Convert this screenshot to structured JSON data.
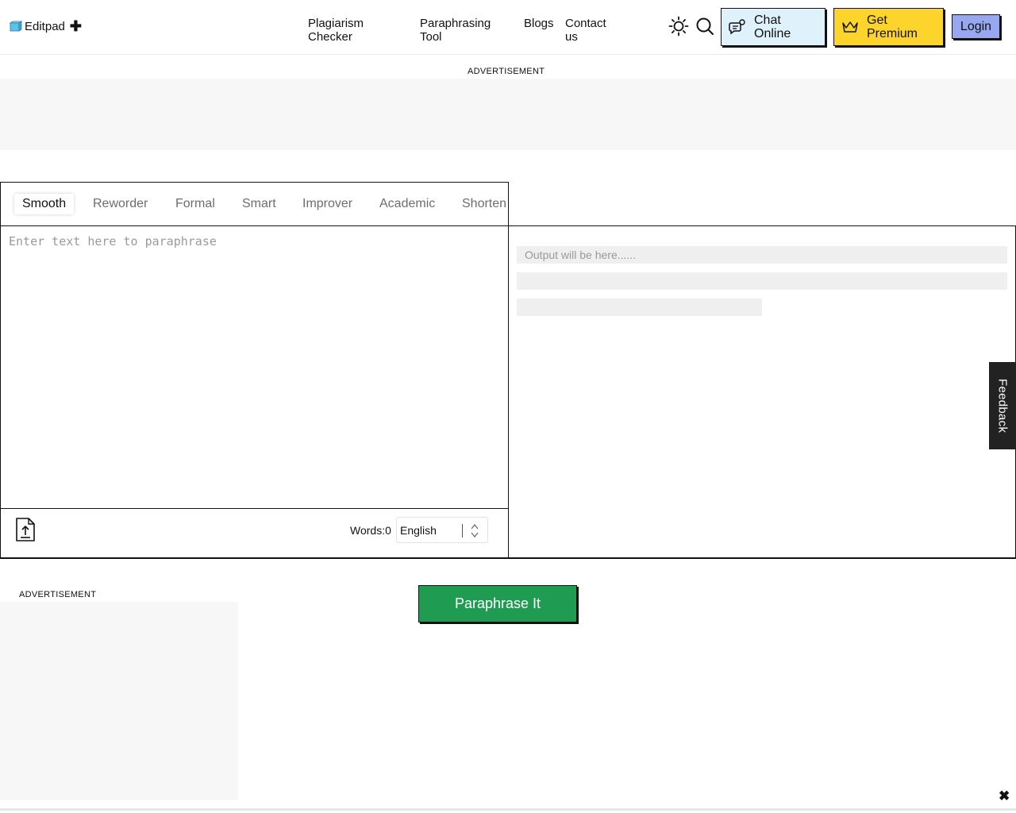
{
  "header": {
    "brand": "Editpad",
    "brand_plus": "✚",
    "nav": [
      {
        "label": "Plagiarism\nChecker"
      },
      {
        "label": "Paraphrasing\nTool"
      },
      {
        "label": "Blogs"
      },
      {
        "label": "Contact\nus"
      }
    ],
    "chat_label": "Chat\nOnline",
    "premium_label": "Get\nPremium",
    "login_label": "Login"
  },
  "ads": {
    "top_label": "ADVERTISEMENT",
    "side_label": "ADVERTISEMENT"
  },
  "tool": {
    "modes": [
      "Smooth",
      "Reworder",
      "Formal",
      "Smart",
      "Improver",
      "Academic",
      "Shorten"
    ],
    "active_mode": "Smooth",
    "input_placeholder": "Enter text here to paraphrase",
    "words_label": "Words:0",
    "language": "English",
    "output_placeholder": "Output will be here......",
    "submit_label": "Paraphrase It"
  },
  "feedback_label": "Feedback",
  "close_glyph": "✖",
  "colors": {
    "chat_bg": "#dff1fb",
    "premium_bg": "#fdd42b",
    "login_bg": "#98a8f0",
    "submit_bg": "#1f9c52",
    "feedback_bg": "#222222"
  }
}
